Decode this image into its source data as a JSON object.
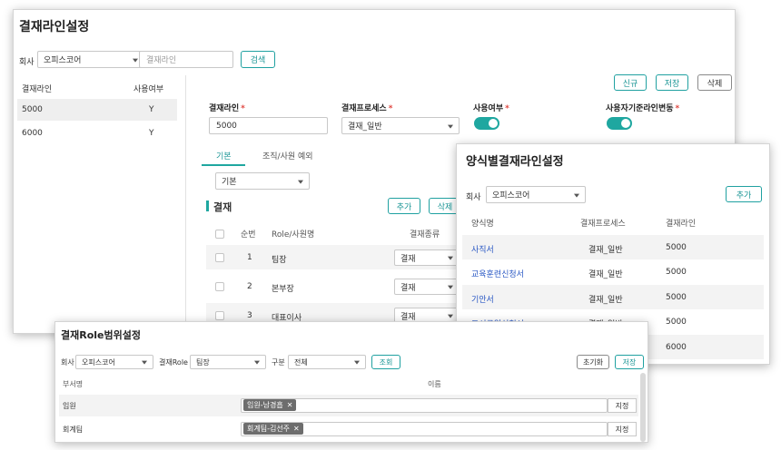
{
  "main_window": {
    "title": "결재라인설정",
    "company_label": "회사",
    "company_value": "오피스코어",
    "line_placeholder": "결재라인",
    "search_button": "검색",
    "new_button": "신규",
    "save_button": "저장",
    "delete_button": "삭제",
    "list": {
      "headers": [
        "결재라인",
        "사용여부"
      ],
      "rows": [
        {
          "name": "5000",
          "use": "Y"
        },
        {
          "name": "6000",
          "use": "Y"
        }
      ]
    },
    "form": {
      "line_label": "결재라인",
      "line_value": "5000",
      "process_label": "결재프로세스",
      "process_value": "결재_일반",
      "use_label": "사용여부",
      "user_change_label": "사용자기준라인변동",
      "use_on": true,
      "user_change_on": true
    },
    "tabs": [
      {
        "label": "기본",
        "active": true
      },
      {
        "label": "조직/사원 예외",
        "active": false
      }
    ],
    "basic_select": "기본",
    "section_title": "결재",
    "add_button": "추가",
    "delete_button2": "삭제",
    "table": {
      "headers": [
        "순번",
        "Role/사원명",
        "결재종류"
      ],
      "rows": [
        {
          "seq": "1",
          "role": "팀장",
          "type": "결재"
        },
        {
          "seq": "2",
          "role": "본부장",
          "type": "결재"
        },
        {
          "seq": "3",
          "role": "대표이사",
          "type": "결재"
        }
      ]
    }
  },
  "form_window": {
    "title": "양식별결재라인설정",
    "company_label": "회사",
    "company_value": "오피스코어",
    "add_button": "추가",
    "headers": [
      "양식명",
      "결재프로세스",
      "결재라인"
    ],
    "rows": [
      {
        "form": "사직서",
        "process": "결재_일반",
        "line": "5000"
      },
      {
        "form": "교육훈련신청서",
        "process": "결재_일반",
        "line": "5000"
      },
      {
        "form": "기안서",
        "process": "결재_일반",
        "line": "5000"
      },
      {
        "form": "도서구입신청서",
        "process": "결재_일반",
        "line": "5000"
      },
      {
        "form": "",
        "process": "",
        "line": "6000"
      }
    ]
  },
  "role_window": {
    "title": "결재Role범위설정",
    "company_label": "회사",
    "company_value": "오피스코어",
    "role_label": "결재Role",
    "role_value": "팀장",
    "category_label": "구분",
    "category_value": "전체",
    "search_button": "조회",
    "reset_button": "초기화",
    "save_button": "저장",
    "headers": [
      "부서명",
      "이름"
    ],
    "rows": [
      {
        "dept": "임원",
        "tag": "임원-남경흡",
        "action": "지정"
      },
      {
        "dept": "회계팀",
        "tag": "회계팀-김선주",
        "action": "지정"
      }
    ]
  },
  "colors": {
    "accent": "#1fa7a0",
    "link": "#2a58c4",
    "required": "#e0463f"
  }
}
